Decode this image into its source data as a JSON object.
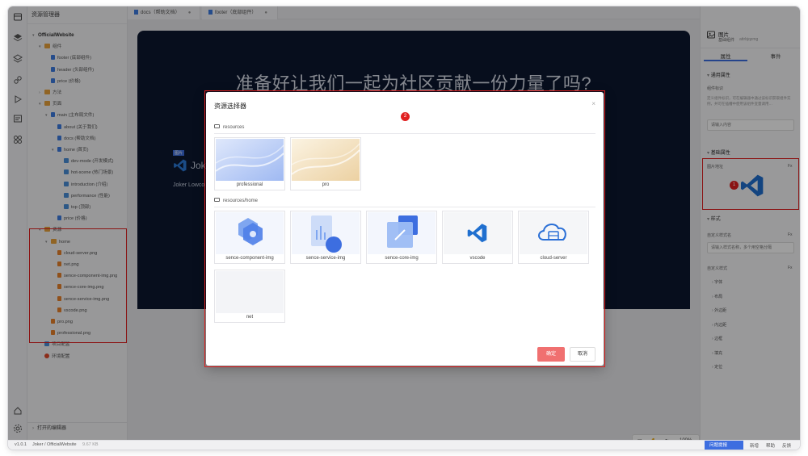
{
  "explorer": {
    "title": "资源管理器",
    "open_editors": "打开的编辑器",
    "rows": [
      {
        "label": "OfficialWebsite",
        "depth": 0,
        "type": "root",
        "open": true
      },
      {
        "label": "组件",
        "depth": 1,
        "type": "folder",
        "open": true
      },
      {
        "label": "footer (底部组件)",
        "depth": 2,
        "type": "file"
      },
      {
        "label": "header (头部组件)",
        "depth": 2,
        "type": "file"
      },
      {
        "label": "price (价格)",
        "depth": 2,
        "type": "file"
      },
      {
        "label": "方法",
        "depth": 1,
        "type": "folder",
        "open": false
      },
      {
        "label": "页面",
        "depth": 1,
        "type": "folder",
        "open": true
      },
      {
        "label": "main (主布局文件)",
        "depth": 2,
        "type": "file",
        "open": true
      },
      {
        "label": "about (关于我们)",
        "depth": 3,
        "type": "file"
      },
      {
        "label": "docs (帮助文档)",
        "depth": 3,
        "type": "file"
      },
      {
        "label": "home (首页)",
        "depth": 3,
        "type": "file",
        "open": true
      },
      {
        "label": "dev-mode (开发模式)",
        "depth": 4,
        "type": "pkg"
      },
      {
        "label": "hot-scene (热门场景)",
        "depth": 4,
        "type": "pkg"
      },
      {
        "label": "introduction (介绍)",
        "depth": 4,
        "type": "pkg"
      },
      {
        "label": "performance (性能)",
        "depth": 4,
        "type": "pkg"
      },
      {
        "label": "top (顶部)",
        "depth": 4,
        "type": "pkg"
      },
      {
        "label": "price (价格)",
        "depth": 3,
        "type": "file"
      },
      {
        "label": "资源",
        "depth": 1,
        "type": "folder",
        "open": true
      },
      {
        "label": "home",
        "depth": 2,
        "type": "folder",
        "open": true
      },
      {
        "label": "cloud-server.png",
        "depth": 3,
        "type": "img"
      },
      {
        "label": "net.png",
        "depth": 3,
        "type": "img"
      },
      {
        "label": "sence-component-img.png",
        "depth": 3,
        "type": "img"
      },
      {
        "label": "sence-core-img.png",
        "depth": 3,
        "type": "img"
      },
      {
        "label": "sence-service-img.png",
        "depth": 3,
        "type": "img"
      },
      {
        "label": "vscode.png",
        "depth": 3,
        "type": "img"
      },
      {
        "label": "pro.png",
        "depth": 2,
        "type": "img"
      },
      {
        "label": "professional.png",
        "depth": 2,
        "type": "img"
      },
      {
        "label": "项目配置",
        "depth": 1,
        "type": "pkg"
      },
      {
        "label": "环境配置",
        "depth": 1,
        "type": "env"
      }
    ]
  },
  "tabs": [
    {
      "label": "docs（帮助文档）"
    },
    {
      "label": "footer（底部组件）"
    }
  ],
  "hero": {
    "title": "准备好让我们一起为社区贡献一份力量了吗?",
    "badge": "图片",
    "logo_text": "Joker",
    "subtitle": "Joker Lowco"
  },
  "zoom": {
    "value": "100%"
  },
  "props": {
    "component_title": "图片",
    "component_type": "基础组件",
    "component_id": "attrbjqzmg",
    "tab_props": "属性",
    "tab_events": "事件",
    "general_section": "通用属性",
    "component_id_label": "组件标识",
    "component_id_help": "定义组件标识，可在编辑器中通过该标识获取组件实例，并可在插槽中使用该组件变量调用…",
    "component_id_placeholder": "请输入内容",
    "basic_section": "基础属性",
    "image_url_label": "图片地址",
    "fx": "Fx",
    "style_section": "样式",
    "custom_class_label": "自定义样式名",
    "custom_class_placeholder": "请输入样式名称，多个用空格分隔",
    "custom_style_label": "自定义样式",
    "style_items": [
      "字体",
      "布局",
      "外边距",
      "内边距",
      "边框",
      "填充",
      "定位"
    ]
  },
  "dialog": {
    "title": "资源选择器",
    "close": "×",
    "group1": "resources",
    "group2": "resources/home",
    "group1_items": [
      "professional",
      "pro"
    ],
    "group2_items": [
      "sence-component-img",
      "sence-service-img",
      "sence-core-img",
      "vscode",
      "cloud-server",
      "net"
    ],
    "ok": "确定",
    "cancel": "取消"
  },
  "markers": {
    "m1": "1",
    "m2": "2"
  },
  "statusbar": {
    "version": "v1.0.1",
    "path": "Joker / OfficialWebsite",
    "size": "9.67 KB",
    "help": "问题提报",
    "item1": "新增",
    "item2": "帮助",
    "item3": "反馈"
  },
  "colors": {
    "accent": "#3d6ee0",
    "danger": "#e02020",
    "ok_button": "#f07070",
    "hero_bg": "#0c1830"
  }
}
